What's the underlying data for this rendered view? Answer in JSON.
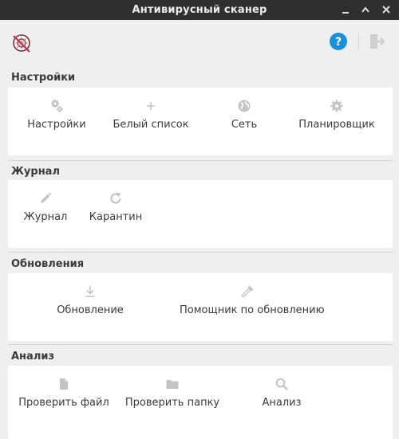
{
  "window": {
    "title": "Антивирусный сканер"
  },
  "colors": {
    "titlebar": "#2f2f2f",
    "accent": "#1b8fd8",
    "icon": "#c4c4c4",
    "panel": "#ffffff",
    "background": "#efefef"
  },
  "header": {
    "logo_icon": "clamav-logo-icon",
    "help_icon": "help-icon",
    "exit_icon": "exit-icon"
  },
  "sections": [
    {
      "title": "Настройки",
      "items": [
        {
          "label": "Настройки",
          "icon": "settings-gears-icon"
        },
        {
          "label": "Белый список",
          "icon": "plus-icon"
        },
        {
          "label": "Сеть",
          "icon": "globe-icon"
        },
        {
          "label": "Планировщик",
          "icon": "gear-icon"
        }
      ]
    },
    {
      "title": "Журнал",
      "items": [
        {
          "label": "Журнал",
          "icon": "pencil-icon"
        },
        {
          "label": "Карантин",
          "icon": "refresh-icon"
        }
      ]
    },
    {
      "title": "Обновления",
      "items": [
        {
          "label": "Обновление",
          "icon": "download-icon"
        },
        {
          "label": "Помощник по обновлению",
          "icon": "pipette-icon"
        }
      ]
    },
    {
      "title": "Анализ",
      "items": [
        {
          "label": "Проверить файл",
          "icon": "file-icon"
        },
        {
          "label": "Проверить папку",
          "icon": "folder-icon"
        },
        {
          "label": "Анализ",
          "icon": "search-icon"
        }
      ]
    }
  ]
}
